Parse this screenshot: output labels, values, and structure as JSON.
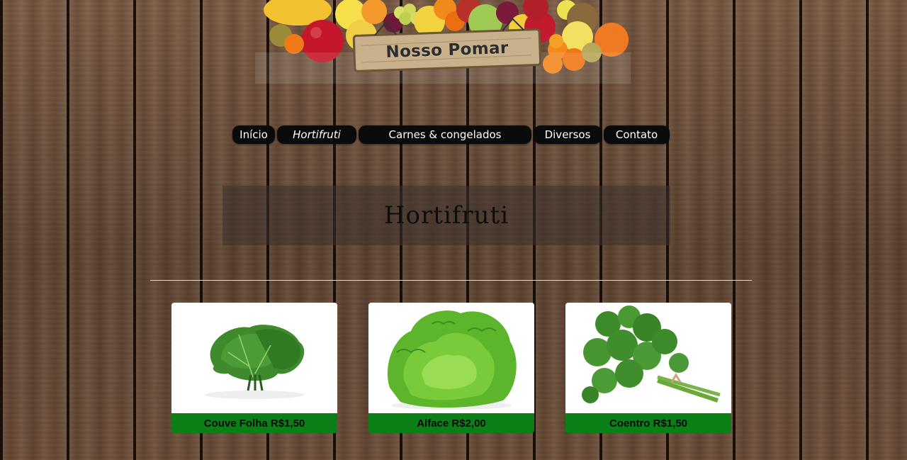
{
  "header": {
    "logo_text": "Nosso Pomar"
  },
  "nav": {
    "items": [
      {
        "label": "Início",
        "active": false
      },
      {
        "label": "Hortifruti",
        "active": true
      },
      {
        "label": "Carnes & congelados",
        "active": false
      },
      {
        "label": "Diversos",
        "active": false
      },
      {
        "label": "Contato",
        "active": false
      }
    ]
  },
  "page": {
    "title": "Hortifruti"
  },
  "products": [
    {
      "label": "Couve Folha R$1,50",
      "icon": "kale-image"
    },
    {
      "label": "Alface R$2,00",
      "icon": "lettuce-image"
    },
    {
      "label": "Coentro R$1,50",
      "icon": "cilantro-image"
    }
  ],
  "colors": {
    "nav_bg": "#0a0a0a",
    "price_bar": "#0b7e16",
    "title_box": "rgba(60,50,45,0.55)"
  }
}
